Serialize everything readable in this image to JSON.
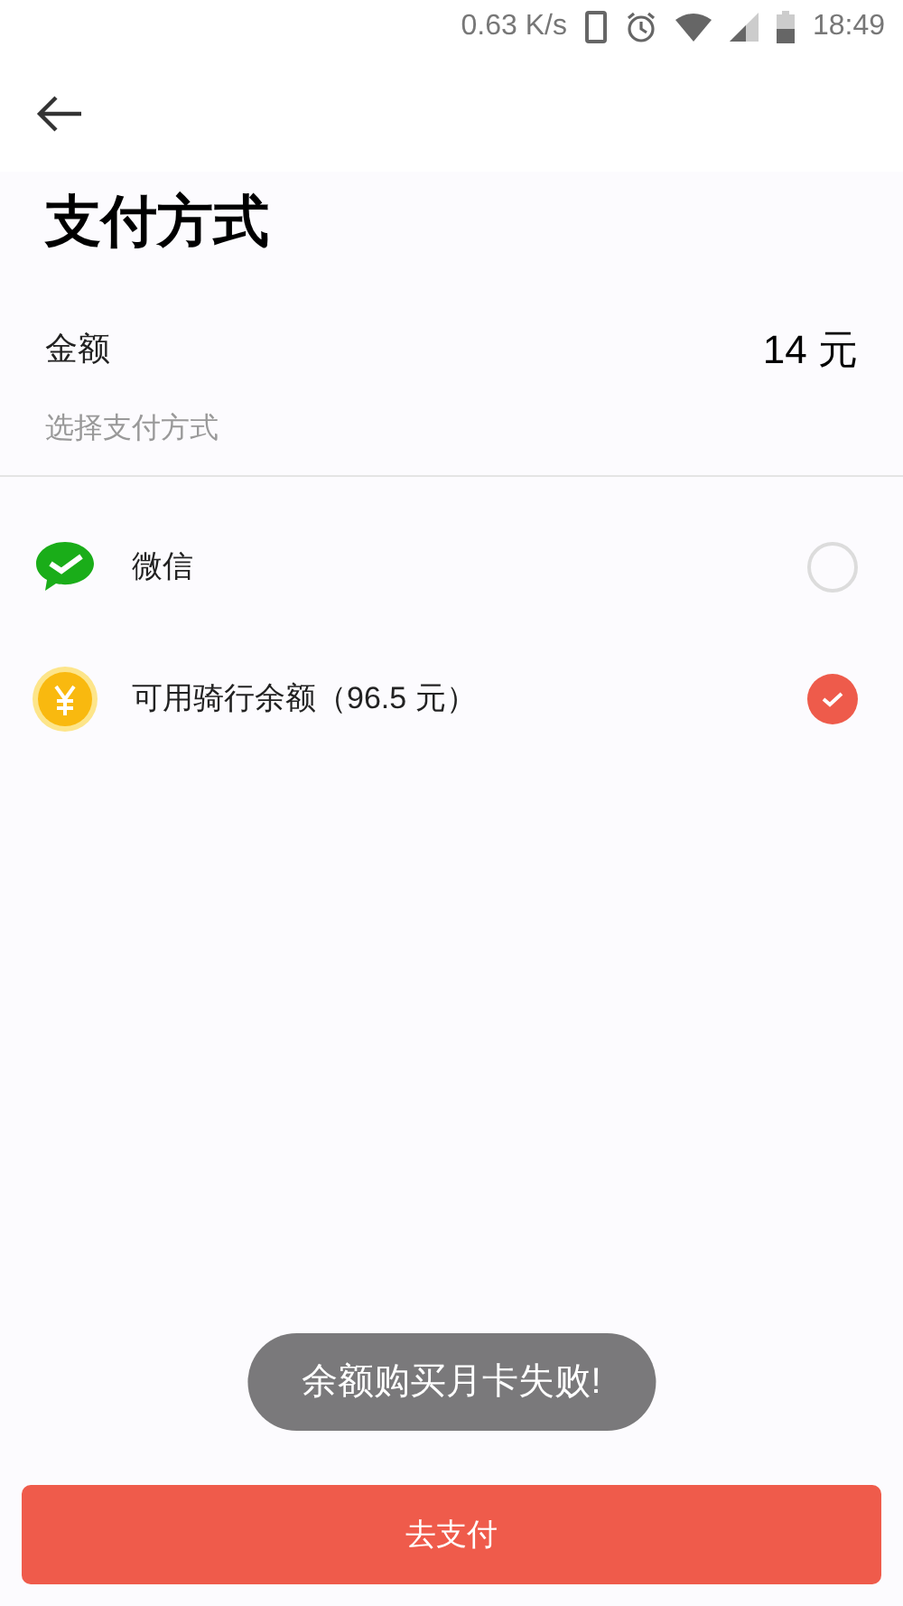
{
  "status_bar": {
    "speed": "0.63 K/s",
    "time": "18:49"
  },
  "title": "支付方式",
  "amount": {
    "label": "金额",
    "value": "14 元"
  },
  "hint": "选择支付方式",
  "methods": [
    {
      "kind": "wechat",
      "label": "微信",
      "selected": false
    },
    {
      "kind": "balance",
      "label": "可用骑行余额（96.5 元）",
      "selected": true
    }
  ],
  "toast": "余额购买月卡失败!",
  "pay_button": "去支付"
}
